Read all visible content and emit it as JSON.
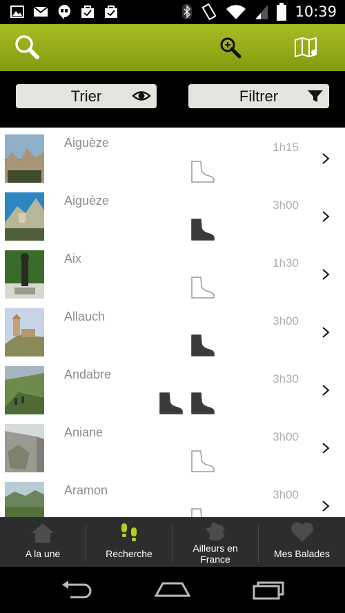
{
  "status_bar": {
    "time": "10:39",
    "left_icons": [
      "image-icon",
      "mail-icon",
      "hangouts-icon",
      "bag-check-icon",
      "bag-check-icon"
    ],
    "right_icons": [
      "bluetooth-icon",
      "vibrate-icon",
      "wifi-icon",
      "signal-icon",
      "battery-icon"
    ]
  },
  "action_bar": {
    "icons": [
      "search-icon",
      "zoom-in-icon",
      "map-icon"
    ],
    "accent": "#9bb118"
  },
  "toolbar": {
    "sort_label": "Trier",
    "filter_label": "Filtrer"
  },
  "list": {
    "items": [
      {
        "name": "Aiguèze",
        "duration": "1h15",
        "boots": [
          "outline"
        ]
      },
      {
        "name": "Aiguèze",
        "duration": "3h00",
        "boots": [
          "filled"
        ]
      },
      {
        "name": "Aix",
        "duration": "1h30",
        "boots": [
          "outline"
        ]
      },
      {
        "name": "Allauch",
        "duration": "3h00",
        "boots": [
          "filled"
        ]
      },
      {
        "name": "Andabre",
        "duration": "3h30",
        "boots": [
          "filled",
          "filled"
        ]
      },
      {
        "name": "Aniane",
        "duration": "3h00",
        "boots": [
          "outline"
        ]
      },
      {
        "name": "Aramon",
        "duration": "3h00",
        "boots": [
          "outline"
        ]
      }
    ]
  },
  "bottom_nav": {
    "items": [
      {
        "label": "A la une",
        "icon": "home-icon",
        "active": false
      },
      {
        "label": "Recherche",
        "icon": "footprints-icon",
        "active": true
      },
      {
        "label": "Ailleurs en France",
        "icon": "france-map-icon",
        "active": false
      },
      {
        "label": "Mes Balades",
        "icon": "heart-icon",
        "active": false
      }
    ]
  },
  "system_nav": {
    "icons": [
      "back-icon",
      "home-icon",
      "recents-icon"
    ]
  }
}
